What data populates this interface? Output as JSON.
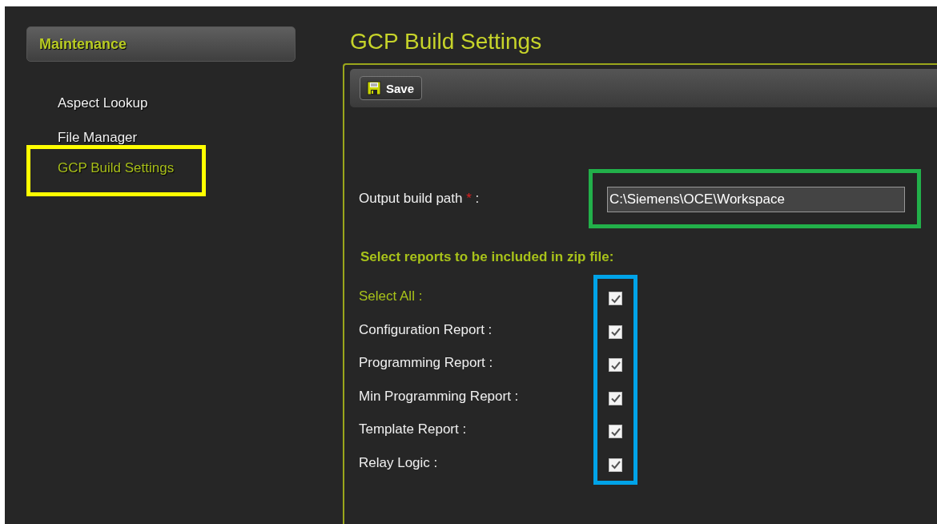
{
  "sidebar": {
    "header": "Maintenance",
    "items": [
      {
        "label": "Aspect Lookup",
        "selected": false,
        "highlighted": false
      },
      {
        "label": "File Manager",
        "selected": false,
        "highlighted": false
      },
      {
        "label": "GCP Build Settings",
        "selected": true,
        "highlighted": true
      }
    ]
  },
  "main": {
    "title": "GCP Build Settings",
    "toolbar": {
      "save_button": "Save"
    },
    "output_path": {
      "label": "Output build path",
      "required_mark": "*",
      "colon": ":",
      "value": "C:\\Siemens\\OCE\\Workspace",
      "highlighted": true
    },
    "reports_heading": "Select reports to be included in zip file:",
    "reports_highlighted": true,
    "reports": [
      {
        "kind": "select_all",
        "label": "Select All :",
        "checked": true
      },
      {
        "kind": "report",
        "label": "Configuration Report :",
        "checked": true
      },
      {
        "kind": "report",
        "label": "Programming Report :",
        "checked": true
      },
      {
        "kind": "report",
        "label": "Min Programming Report :",
        "checked": true
      },
      {
        "kind": "report",
        "label": "Template Report :",
        "checked": true
      },
      {
        "kind": "report",
        "label": "Relay Logic :",
        "checked": true
      }
    ]
  }
}
